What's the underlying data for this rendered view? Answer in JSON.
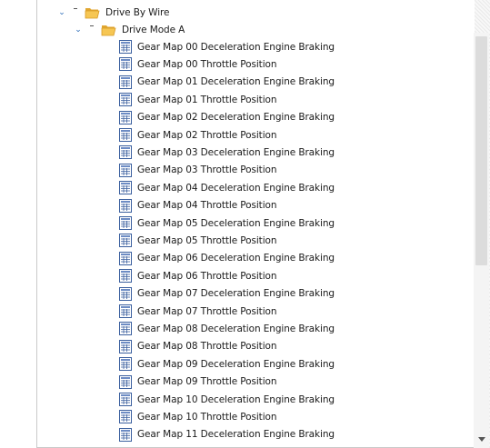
{
  "tree": {
    "folders": [
      {
        "label": "Drive By Wire",
        "expanded": true
      },
      {
        "label": "Drive Mode A",
        "expanded": true
      }
    ],
    "items": [
      "Gear Map 00 Deceleration Engine Braking",
      "Gear Map 00 Throttle Position",
      "Gear Map 01 Deceleration Engine Braking",
      "Gear Map 01 Throttle Position",
      "Gear Map 02 Deceleration Engine Braking",
      "Gear Map 02 Throttle Position",
      "Gear Map 03 Deceleration Engine Braking",
      "Gear Map 03 Throttle Position",
      "Gear Map 04 Deceleration Engine Braking",
      "Gear Map 04 Throttle Position",
      "Gear Map 05 Deceleration Engine Braking",
      "Gear Map 05 Throttle Position",
      "Gear Map 06 Deceleration Engine Braking",
      "Gear Map 06 Throttle Position",
      "Gear Map 07 Deceleration Engine Braking",
      "Gear Map 07 Throttle Position",
      "Gear Map 08 Deceleration Engine Braking",
      "Gear Map 08 Throttle Position",
      "Gear Map 09 Deceleration Engine Braking",
      "Gear Map 09 Throttle Position",
      "Gear Map 10 Deceleration Engine Braking",
      "Gear Map 10 Throttle Position",
      "Gear Map 11 Deceleration Engine Braking"
    ],
    "icons": {
      "folder": "open-folder-icon",
      "item": "table-document-icon",
      "expander": "chevron-down-icon",
      "scroll_down": "scroll-down-arrow-icon"
    }
  },
  "colors": {
    "expander": "#2b6cb8",
    "folder": "#f3c04a",
    "doc_border": "#3a5f9e"
  }
}
